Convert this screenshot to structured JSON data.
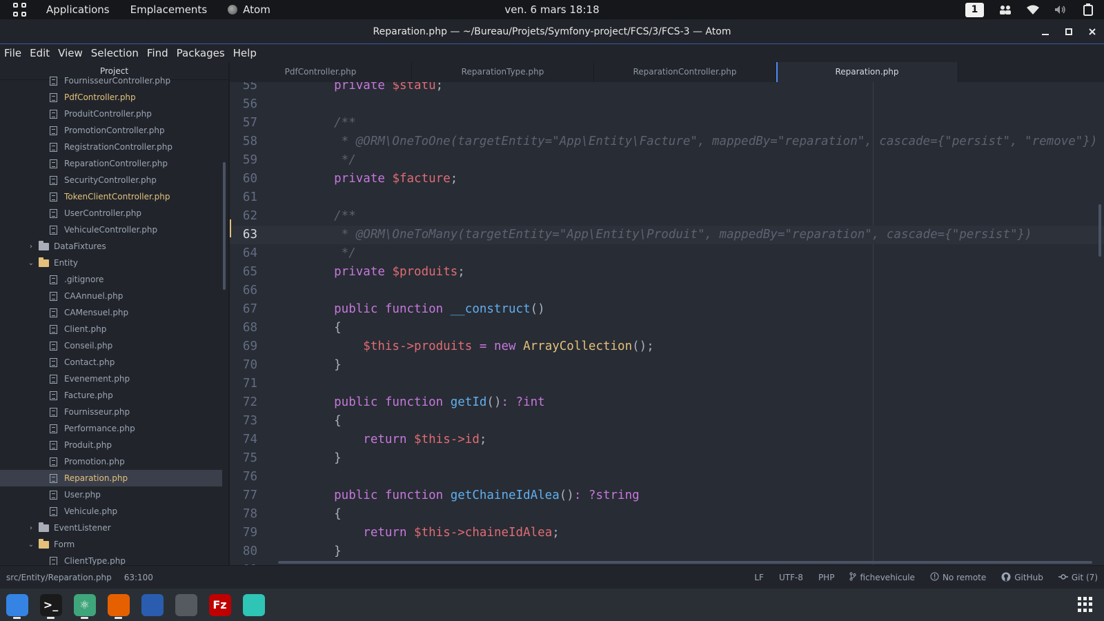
{
  "topbar": {
    "activities": "Applications",
    "places": "Emplacements",
    "active_app": "Atom",
    "clock": "ven. 6 mars  18:18",
    "workspace": "1"
  },
  "window": {
    "title": "Reparation.php — ~/Bureau/Projets/Symfony-project/FCS/3/FCS-3 — Atom"
  },
  "menu": [
    "File",
    "Edit",
    "View",
    "Selection",
    "Find",
    "Packages",
    "Help"
  ],
  "tree": {
    "header": "Project",
    "rows": [
      {
        "type": "file",
        "depth": 2,
        "label": "FournisseurController.php",
        "modified": false
      },
      {
        "type": "file",
        "depth": 2,
        "label": "PdfController.php",
        "modified": true
      },
      {
        "type": "file",
        "depth": 2,
        "label": "ProduitController.php",
        "modified": false
      },
      {
        "type": "file",
        "depth": 2,
        "label": "PromotionController.php",
        "modified": false
      },
      {
        "type": "file",
        "depth": 2,
        "label": "RegistrationController.php",
        "modified": false
      },
      {
        "type": "file",
        "depth": 2,
        "label": "ReparationController.php",
        "modified": false
      },
      {
        "type": "file",
        "depth": 2,
        "label": "SecurityController.php",
        "modified": false
      },
      {
        "type": "file",
        "depth": 2,
        "label": "TokenClientController.php",
        "modified": true
      },
      {
        "type": "file",
        "depth": 2,
        "label": "UserController.php",
        "modified": false
      },
      {
        "type": "file",
        "depth": 2,
        "label": "VehiculeController.php",
        "modified": false
      },
      {
        "type": "folder",
        "depth": 1,
        "label": "DataFixtures",
        "open": false
      },
      {
        "type": "folder",
        "depth": 1,
        "label": "Entity",
        "open": true
      },
      {
        "type": "file",
        "depth": 2,
        "label": ".gitignore",
        "modified": false
      },
      {
        "type": "file",
        "depth": 2,
        "label": "CAAnnuel.php",
        "modified": false
      },
      {
        "type": "file",
        "depth": 2,
        "label": "CAMensuel.php",
        "modified": false
      },
      {
        "type": "file",
        "depth": 2,
        "label": "Client.php",
        "modified": false
      },
      {
        "type": "file",
        "depth": 2,
        "label": "Conseil.php",
        "modified": false
      },
      {
        "type": "file",
        "depth": 2,
        "label": "Contact.php",
        "modified": false
      },
      {
        "type": "file",
        "depth": 2,
        "label": "Evenement.php",
        "modified": false
      },
      {
        "type": "file",
        "depth": 2,
        "label": "Facture.php",
        "modified": false
      },
      {
        "type": "file",
        "depth": 2,
        "label": "Fournisseur.php",
        "modified": false
      },
      {
        "type": "file",
        "depth": 2,
        "label": "Performance.php",
        "modified": false
      },
      {
        "type": "file",
        "depth": 2,
        "label": "Produit.php",
        "modified": false
      },
      {
        "type": "file",
        "depth": 2,
        "label": "Promotion.php",
        "modified": false
      },
      {
        "type": "file",
        "depth": 2,
        "label": "Reparation.php",
        "modified": true,
        "selected": true
      },
      {
        "type": "file",
        "depth": 2,
        "label": "User.php",
        "modified": false
      },
      {
        "type": "file",
        "depth": 2,
        "label": "Vehicule.php",
        "modified": false
      },
      {
        "type": "folder",
        "depth": 1,
        "label": "EventListener",
        "open": false
      },
      {
        "type": "folder",
        "depth": 1,
        "label": "Form",
        "open": true
      },
      {
        "type": "file",
        "depth": 2,
        "label": "ClientType.php",
        "modified": false
      }
    ]
  },
  "tabs": [
    {
      "label": "PdfController.php",
      "active": false
    },
    {
      "label": "ReparationType.php",
      "active": false
    },
    {
      "label": "ReparationController.php",
      "active": false
    },
    {
      "label": "Reparation.php",
      "active": true
    }
  ],
  "editor": {
    "current_line": 63,
    "lines": [
      {
        "n": "55",
        "tokens": [
          [
            "kw",
            "    private "
          ],
          [
            "var",
            "$statu"
          ],
          [
            "pl",
            ";"
          ]
        ]
      },
      {
        "n": "56",
        "tokens": []
      },
      {
        "n": "57",
        "tokens": [
          [
            "cm",
            "    /**"
          ]
        ]
      },
      {
        "n": "58",
        "tokens": [
          [
            "cm",
            "     * @ORM\\OneToOne(targetEntity=\"App\\Entity\\Facture\", mappedBy=\"reparation\", cascade={\"persist\", \"remove\"})"
          ]
        ]
      },
      {
        "n": "59",
        "tokens": [
          [
            "cm",
            "     */"
          ]
        ]
      },
      {
        "n": "60",
        "tokens": [
          [
            "kw",
            "    private "
          ],
          [
            "var",
            "$facture"
          ],
          [
            "pl",
            ";"
          ]
        ]
      },
      {
        "n": "61",
        "tokens": []
      },
      {
        "n": "62",
        "tokens": [
          [
            "cm",
            "    /**"
          ]
        ]
      },
      {
        "n": "63",
        "tokens": [
          [
            "cm",
            "     * @ORM\\OneToMany(targetEntity=\"App\\Entity\\Produit\", mappedBy=\"reparation\", cascade={\"persist\"})"
          ]
        ]
      },
      {
        "n": "64",
        "tokens": [
          [
            "cm",
            "     */"
          ]
        ]
      },
      {
        "n": "65",
        "tokens": [
          [
            "kw",
            "    private "
          ],
          [
            "var",
            "$produits"
          ],
          [
            "pl",
            ";"
          ]
        ]
      },
      {
        "n": "66",
        "tokens": []
      },
      {
        "n": "67",
        "tokens": [
          [
            "kw",
            "    public function "
          ],
          [
            "fn",
            "__construct"
          ],
          [
            "pl",
            "()"
          ]
        ]
      },
      {
        "n": "68",
        "tokens": [
          [
            "pl",
            "    {"
          ]
        ]
      },
      {
        "n": "69",
        "tokens": [
          [
            "var",
            "        $this->produits "
          ],
          [
            "kw",
            "= new "
          ],
          [
            "cls",
            "ArrayCollection"
          ],
          [
            "pl",
            "();"
          ]
        ]
      },
      {
        "n": "70",
        "tokens": [
          [
            "pl",
            "    }"
          ]
        ]
      },
      {
        "n": "71",
        "tokens": []
      },
      {
        "n": "72",
        "tokens": [
          [
            "kw",
            "    public function "
          ],
          [
            "fn",
            "getId"
          ],
          [
            "pl",
            "()"
          ],
          [
            "kw",
            ": ?int"
          ]
        ]
      },
      {
        "n": "73",
        "tokens": [
          [
            "pl",
            "    {"
          ]
        ]
      },
      {
        "n": "74",
        "tokens": [
          [
            "kw",
            "        return "
          ],
          [
            "var",
            "$this->id"
          ],
          [
            "pl",
            ";"
          ]
        ]
      },
      {
        "n": "75",
        "tokens": [
          [
            "pl",
            "    }"
          ]
        ]
      },
      {
        "n": "76",
        "tokens": []
      },
      {
        "n": "77",
        "tokens": [
          [
            "kw",
            "    public function "
          ],
          [
            "fn",
            "getChaineIdAlea"
          ],
          [
            "pl",
            "()"
          ],
          [
            "kw",
            ": ?string"
          ]
        ]
      },
      {
        "n": "78",
        "tokens": [
          [
            "pl",
            "    {"
          ]
        ]
      },
      {
        "n": "79",
        "tokens": [
          [
            "kw",
            "        return "
          ],
          [
            "var",
            "$this->chaineIdAlea"
          ],
          [
            "pl",
            ";"
          ]
        ]
      },
      {
        "n": "80",
        "tokens": [
          [
            "pl",
            "    }"
          ]
        ]
      },
      {
        "n": "81",
        "tokens": []
      }
    ]
  },
  "status": {
    "path": "src/Entity/Reparation.php",
    "cursor": "63:100",
    "line_ending": "LF",
    "encoding": "UTF-8",
    "grammar": "PHP",
    "branch": "fichevehicule",
    "remote": "No remote",
    "github": "GitHub",
    "git": "Git (7)"
  },
  "dock": [
    {
      "name": "files",
      "icon": "folder-icon",
      "color": "#3584e4",
      "glyph": "",
      "running": true
    },
    {
      "name": "terminal",
      "icon": "terminal-icon",
      "color": "#1a1a1a",
      "glyph": ">_",
      "running": true
    },
    {
      "name": "atom",
      "icon": "atom-icon",
      "color": "#3fa57a",
      "glyph": "⚛",
      "running": true
    },
    {
      "name": "firefox",
      "icon": "firefox-icon",
      "color": "#e66000",
      "glyph": "",
      "running": true
    },
    {
      "name": "monitor",
      "icon": "system-monitor-icon",
      "color": "#2a5db0",
      "glyph": "",
      "running": false
    },
    {
      "name": "robot",
      "icon": "robot-icon",
      "color": "#555a60",
      "glyph": "",
      "running": false
    },
    {
      "name": "filezilla",
      "icon": "filezilla-icon",
      "color": "#bf0000",
      "glyph": "Fz",
      "running": false
    },
    {
      "name": "mail",
      "icon": "mail-icon",
      "color": "#2ec4b6",
      "glyph": "",
      "running": false
    }
  ]
}
